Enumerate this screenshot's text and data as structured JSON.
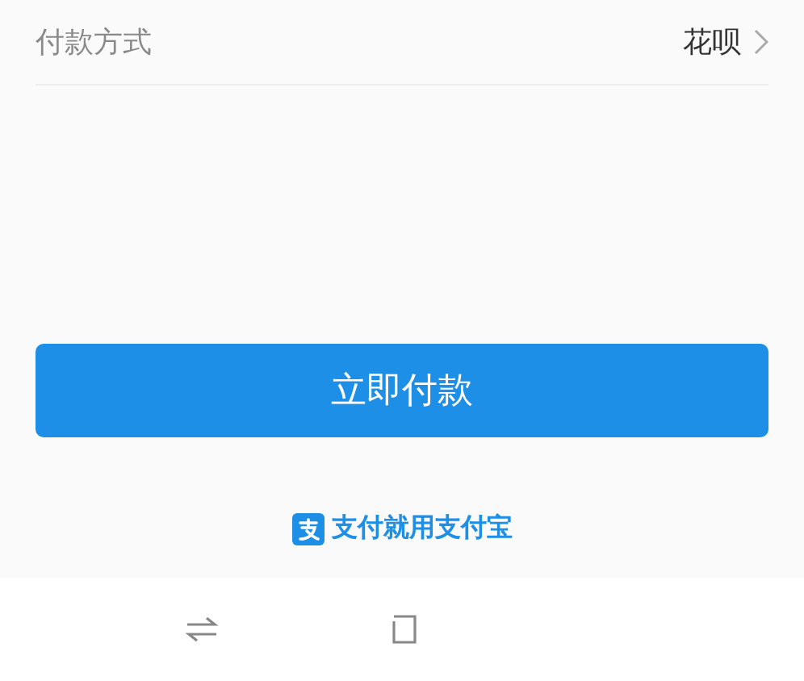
{
  "payment_method": {
    "label": "付款方式",
    "value": "花呗"
  },
  "pay_button": {
    "label": "立即付款"
  },
  "brand_slogan": "支付就用支付宝",
  "nav_bar": {
    "buttons": [
      {
        "kind": "switch"
      },
      {
        "kind": "home"
      }
    ]
  }
}
